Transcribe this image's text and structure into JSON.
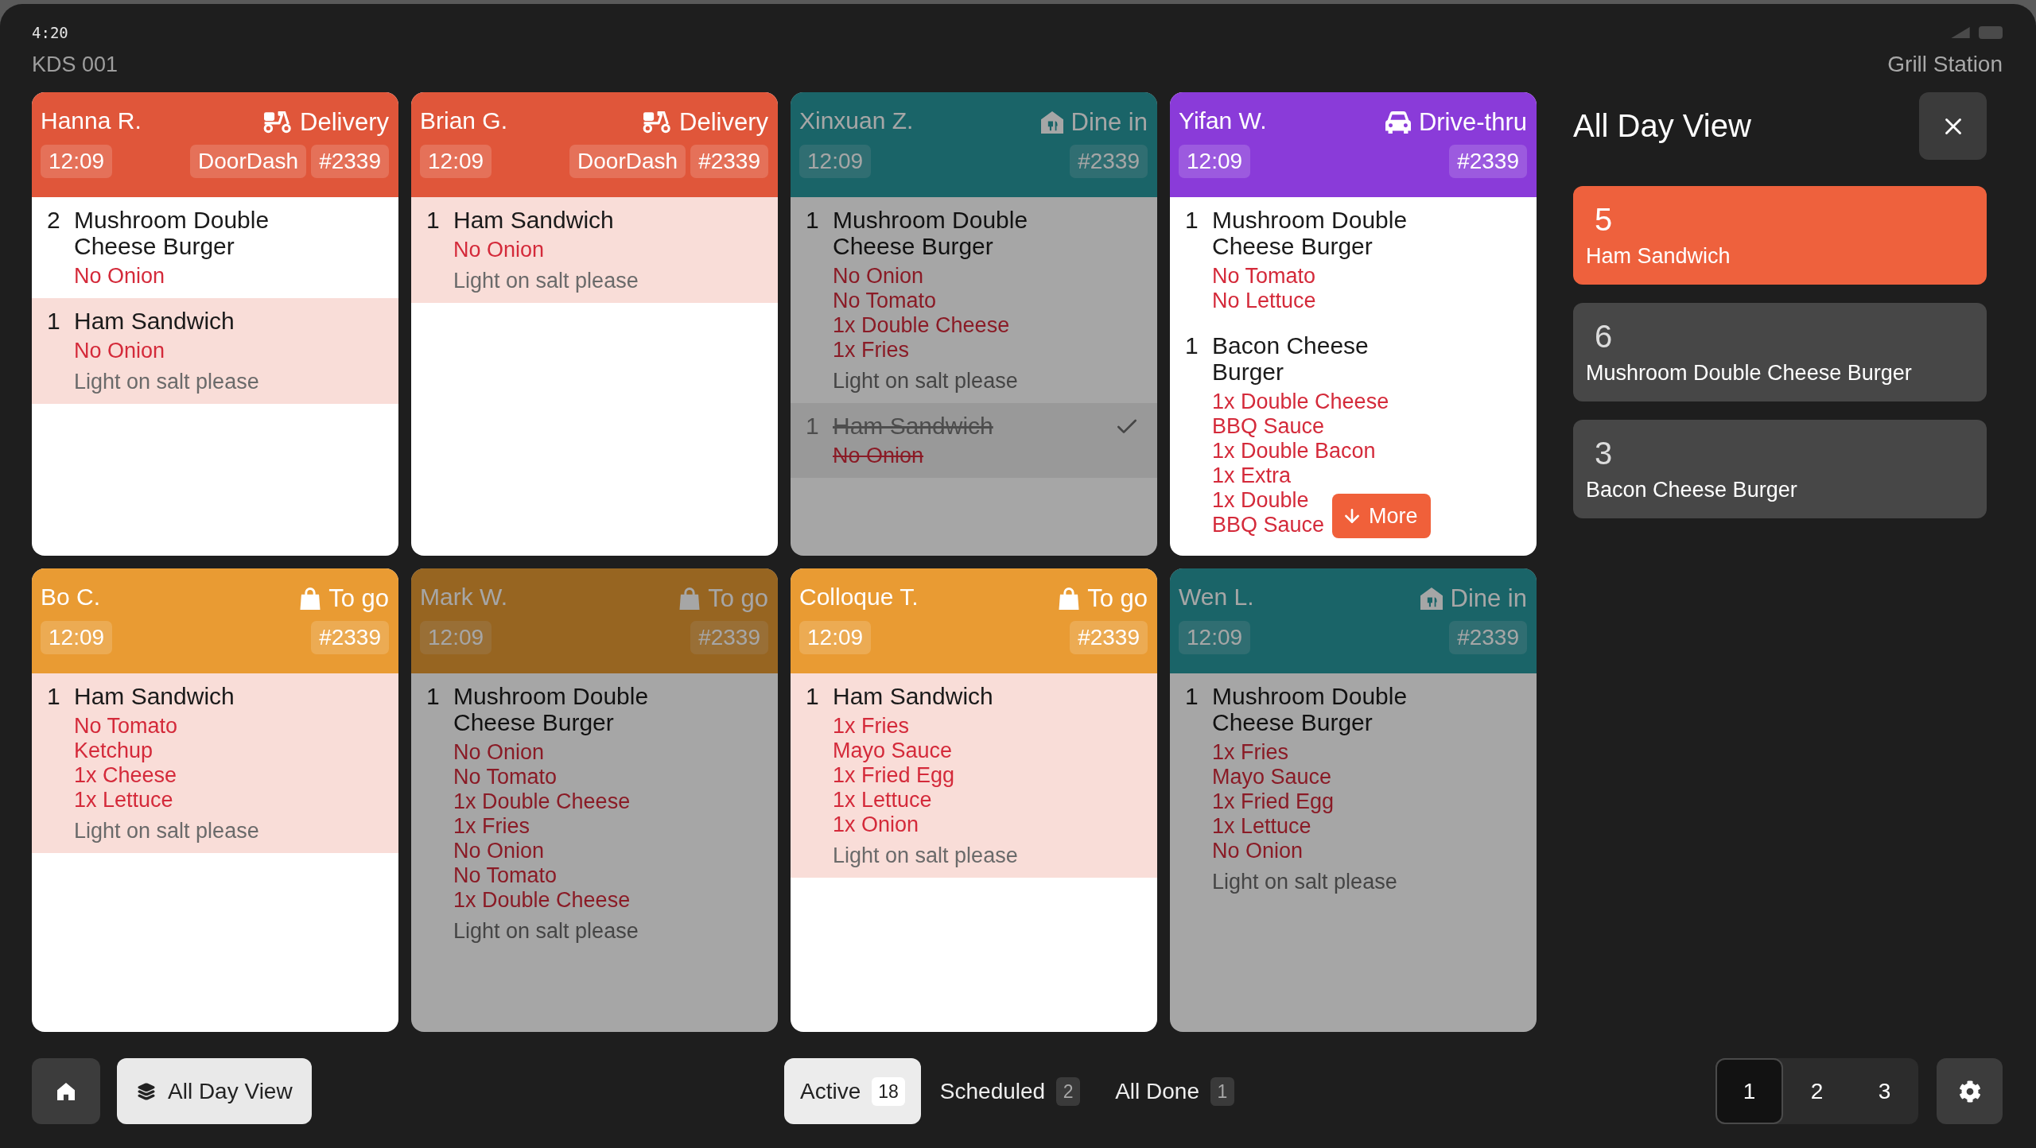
{
  "status_bar": {
    "time": "4:20"
  },
  "header": {
    "device": "KDS 001",
    "station": "Grill Station"
  },
  "orders": [
    {
      "customer": "Hanna R.",
      "kind": "delivery",
      "type_label": "Delivery",
      "time": "12:09",
      "source": "DoorDash",
      "number": "#2339",
      "dimmed": false,
      "items": [
        {
          "qty": "2",
          "name": "Mushroom Double Cheese Burger",
          "modifiers": [
            "No Onion"
          ],
          "highlighted": false,
          "done": false
        },
        {
          "qty": "1",
          "name": "Ham Sandwich",
          "modifiers": [
            "No Onion"
          ],
          "note": "Light on salt please",
          "highlighted": true,
          "done": false
        }
      ]
    },
    {
      "customer": "Brian G.",
      "kind": "delivery",
      "type_label": "Delivery",
      "time": "12:09",
      "source": "DoorDash",
      "number": "#2339",
      "dimmed": false,
      "items": [
        {
          "qty": "1",
          "name": "Ham Sandwich",
          "modifiers": [
            "No Onion"
          ],
          "note": "Light on salt please",
          "highlighted": true,
          "done": false
        }
      ]
    },
    {
      "customer": "Xinxuan Z.",
      "kind": "dine_in",
      "type_label": "Dine in",
      "time": "12:09",
      "number": "#2339",
      "dimmed": true,
      "items": [
        {
          "qty": "1",
          "name": "Mushroom Double Cheese Burger",
          "modifiers": [
            "No Onion",
            "No Tomato",
            "1x Double Cheese",
            "1x Fries"
          ],
          "note": "Light on salt please",
          "highlighted": false,
          "done": false
        },
        {
          "qty": "1",
          "name": "Ham Sandwich",
          "modifiers": [
            "No Onion"
          ],
          "highlighted": false,
          "done": true
        }
      ]
    },
    {
      "customer": "Yifan W.",
      "kind": "drive_thru",
      "type_label": "Drive-thru",
      "time": "12:09",
      "number": "#2339",
      "dimmed": false,
      "more_label": "More",
      "items": [
        {
          "qty": "1",
          "name": "Mushroom Double Cheese Burger",
          "modifiers": [
            "No Tomato",
            "No Lettuce"
          ],
          "highlighted": false,
          "done": false
        },
        {
          "qty": "1",
          "name": "Bacon Cheese Burger",
          "modifiers": [
            "1x Double Cheese",
            "BBQ Sauce",
            "1x Double Bacon",
            "1x Extra",
            "1x Double",
            "BBQ Sauce"
          ],
          "highlighted": false,
          "done": false
        }
      ]
    },
    {
      "customer": "Bo C.",
      "kind": "to_go",
      "type_label": "To go",
      "time": "12:09",
      "number": "#2339",
      "dimmed": false,
      "items": [
        {
          "qty": "1",
          "name": "Ham Sandwich",
          "modifiers": [
            "No Tomato",
            "Ketchup",
            "1x Cheese",
            "1x Lettuce"
          ],
          "note": "Light on salt please",
          "highlighted": true,
          "done": false
        }
      ]
    },
    {
      "customer": "Mark W.",
      "kind": "to_go",
      "type_label": "To go",
      "time": "12:09",
      "number": "#2339",
      "dimmed": true,
      "items": [
        {
          "qty": "1",
          "name": "Mushroom Double Cheese Burger",
          "modifiers": [
            "No Onion",
            "No Tomato",
            "1x Double Cheese",
            "1x Fries",
            "No Onion",
            "No Tomato",
            "1x Double Cheese"
          ],
          "note": "Light on salt please",
          "highlighted": false,
          "done": false
        }
      ]
    },
    {
      "customer": "Colloque T.",
      "kind": "to_go",
      "type_label": "To go",
      "time": "12:09",
      "number": "#2339",
      "dimmed": false,
      "items": [
        {
          "qty": "1",
          "name": "Ham Sandwich",
          "modifiers": [
            "1x Fries",
            "Mayo Sauce",
            "1x Fried Egg",
            "1x Lettuce",
            "1x Onion"
          ],
          "note": "Light on salt please",
          "highlighted": true,
          "done": false
        }
      ]
    },
    {
      "customer": "Wen L.",
      "kind": "dine_in",
      "type_label": "Dine in",
      "time": "12:09",
      "number": "#2339",
      "dimmed": true,
      "items": [
        {
          "qty": "1",
          "name": "Mushroom Double Cheese Burger",
          "modifiers": [
            "1x Fries",
            "Mayo Sauce",
            "1x Fried Egg",
            "1x Lettuce",
            "No Onion"
          ],
          "note": "Light on salt please",
          "highlighted": false,
          "done": false
        }
      ]
    }
  ],
  "all_day_view": {
    "title": "All Day View",
    "items": [
      {
        "count": "5",
        "name": "Ham Sandwich",
        "selected": true
      },
      {
        "count": "6",
        "name": "Mushroom Double Cheese Burger",
        "selected": false
      },
      {
        "count": "3",
        "name": "Bacon Cheese Burger",
        "selected": false
      }
    ]
  },
  "bottom_bar": {
    "all_day_button": "All Day View",
    "tabs": [
      {
        "label": "Active",
        "count": "18",
        "selected": true
      },
      {
        "label": "Scheduled",
        "count": "2",
        "selected": false
      },
      {
        "label": "All Done",
        "count": "1",
        "selected": false
      }
    ],
    "pages": [
      {
        "label": "1",
        "selected": true
      },
      {
        "label": "2",
        "selected": false
      },
      {
        "label": "3",
        "selected": false
      }
    ]
  }
}
